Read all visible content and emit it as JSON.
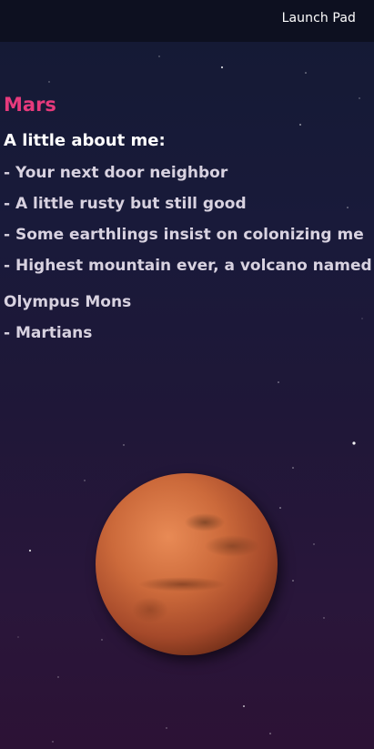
{
  "nav": {
    "link_label": "Launch Pad"
  },
  "planet": {
    "name": "Mars",
    "about_heading": "A little about me:",
    "facts": [
      "- Your next door neighbor",
      "- A little rusty but still good",
      "- Some earthlings insist on colonizing me",
      "- Highest mountain ever, a volcano named Olympus Mons",
      "- Martians"
    ]
  },
  "colors": {
    "title": "#e63a7c",
    "top_bar": "#0d1020",
    "planet_surface": "#cc6a3b"
  },
  "icons": {
    "planet_image": "mars-planet-image"
  }
}
